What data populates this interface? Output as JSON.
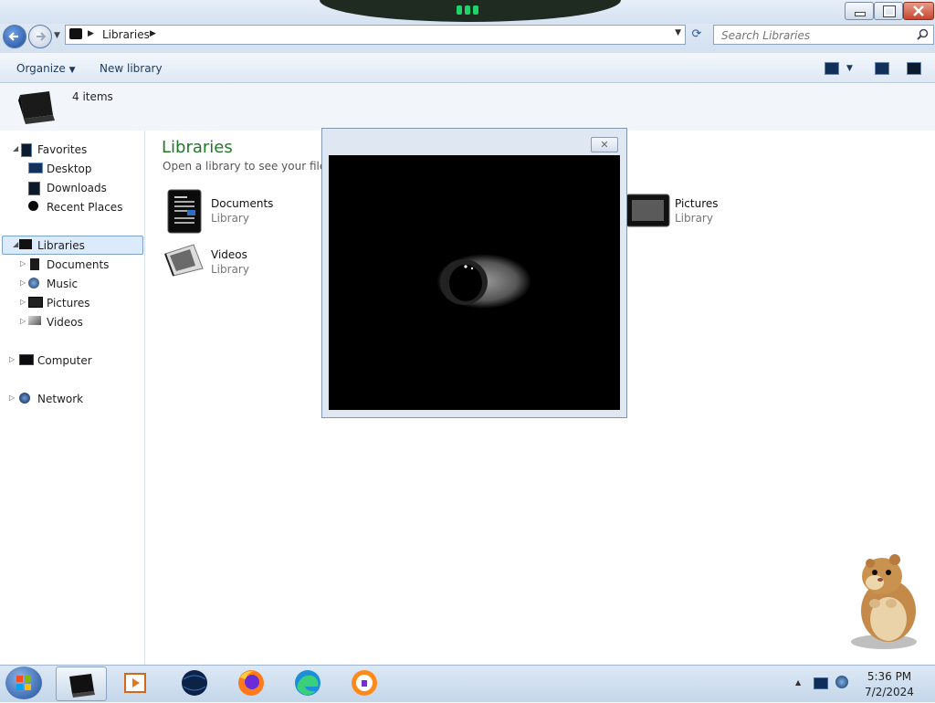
{
  "window": {
    "address_path": "Libraries",
    "search_placeholder": "Search Libraries"
  },
  "toolbar": {
    "organize_label": "Organize",
    "new_library_label": "New library"
  },
  "details": {
    "items_count": "4 items"
  },
  "nav": {
    "favorites": "Favorites",
    "desktop": "Desktop",
    "downloads": "Downloads",
    "recent_places": "Recent Places",
    "libraries": "Libraries",
    "documents": "Documents",
    "music": "Music",
    "pictures": "Pictures",
    "videos": "Videos",
    "computer": "Computer",
    "network": "Network"
  },
  "content": {
    "title": "Libraries",
    "subtitle": "Open a library to see your files an",
    "items": [
      {
        "name": "Documents",
        "type": "Library",
        "icon": "documents-library-icon"
      },
      {
        "name": "Pictures",
        "type": "Library",
        "icon": "pictures-library-icon"
      },
      {
        "name": "Videos",
        "type": "Library",
        "icon": "videos-library-icon"
      }
    ]
  },
  "popup": {
    "close_glyph": "✕"
  },
  "taskbar": {
    "apps": [
      "windows-explorer-icon",
      "media-player-icon",
      "globe-app-icon",
      "firefox-icon",
      "edge-icon",
      "avast-browser-icon"
    ],
    "time": "5:36 PM",
    "date": "7/2/2024"
  },
  "colors": {
    "title_green": "#1e7a28",
    "selection_bg": "#dcebfc",
    "taskbar": "#c4d6ea"
  }
}
